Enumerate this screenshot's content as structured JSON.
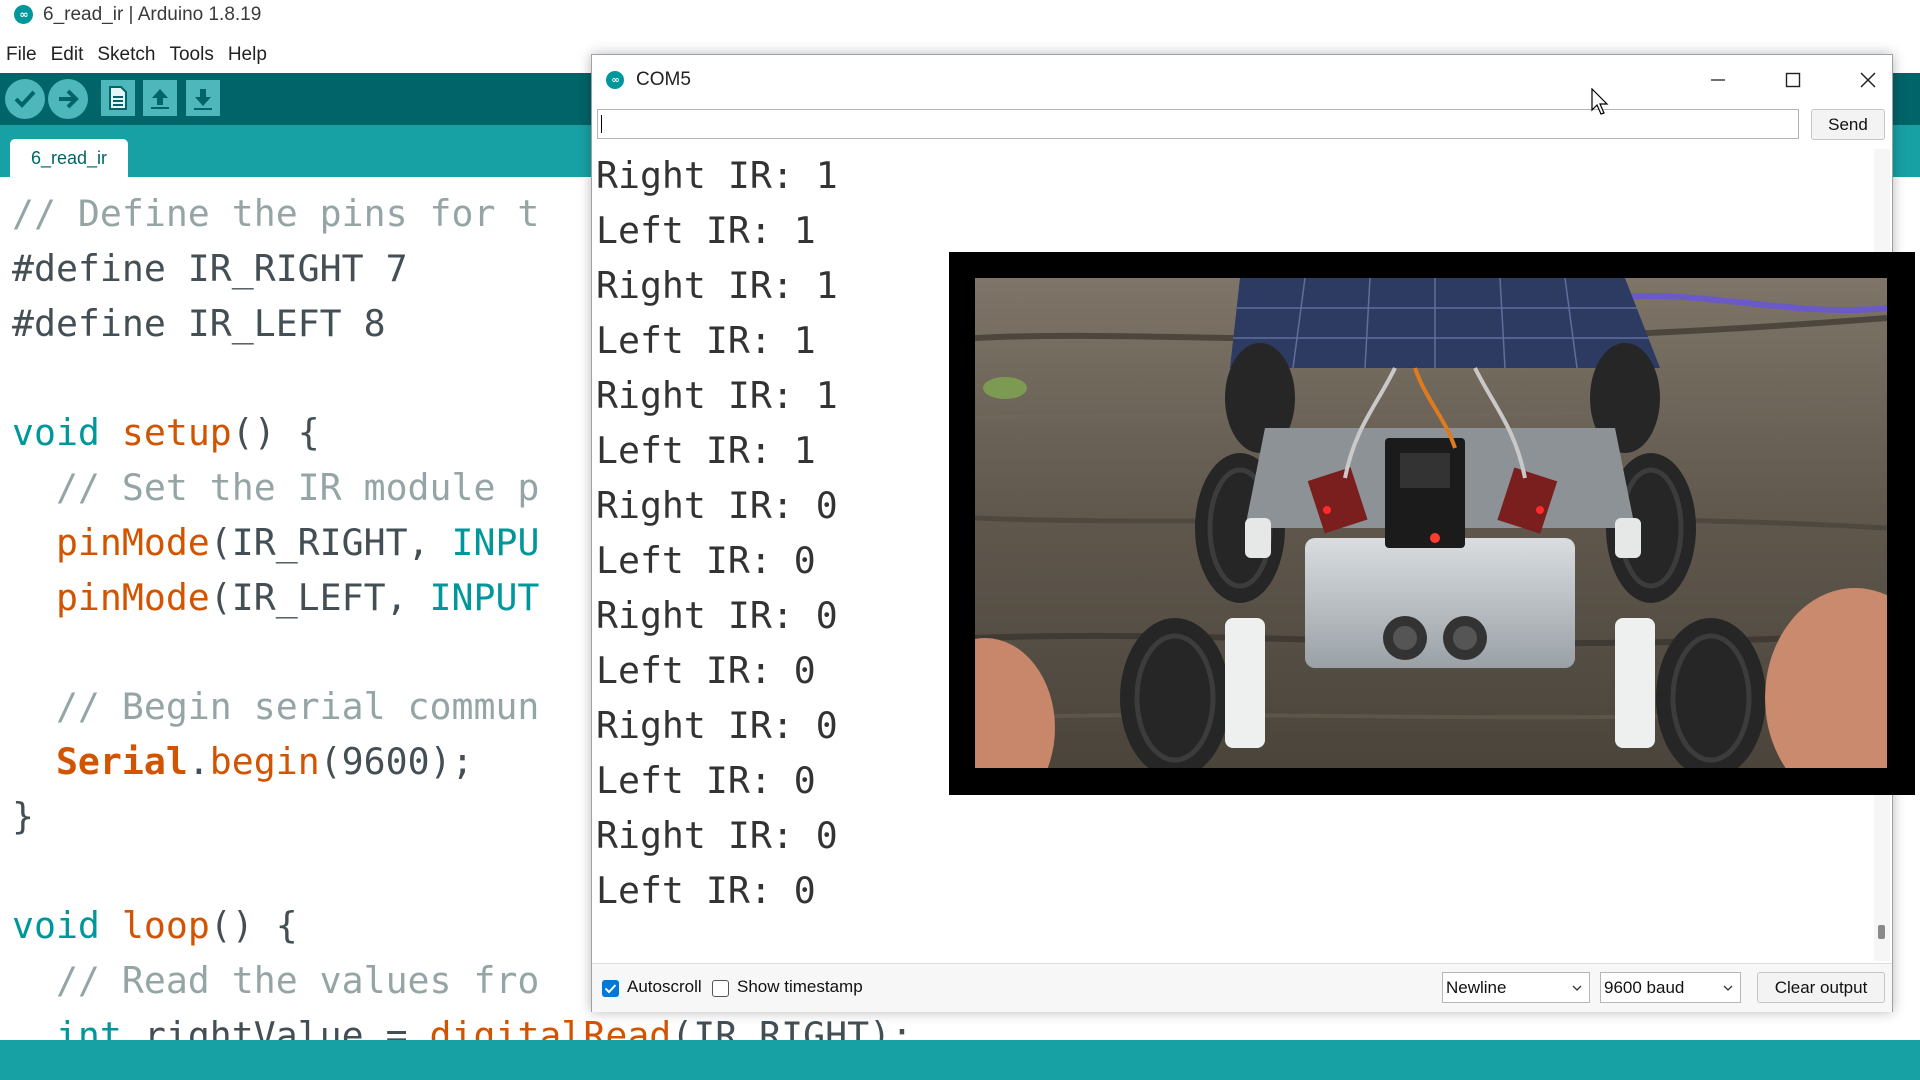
{
  "ide": {
    "window_title": "6_read_ir | Arduino 1.8.19",
    "menu": [
      "File",
      "Edit",
      "Sketch",
      "Tools",
      "Help"
    ],
    "toolbar": {
      "verify_icon": "check-icon",
      "upload_icon": "arrow-right-icon",
      "new_icon": "file-icon",
      "open_icon": "arrow-up-icon",
      "save_icon": "arrow-down-icon"
    },
    "active_tab": "6_read_ir",
    "code": {
      "line1": "// Define the pins for t",
      "line2": "#define IR_RIGHT 7",
      "line3": "#define IR_LEFT 8",
      "line5_kw": "void",
      "line5_fn": "setup",
      "line5_rest": "() {",
      "line6": "// Set the IR module p",
      "line7_fn": "pinMode",
      "line7_rest": "(IR_RIGHT, ",
      "line7_kw": "INPU",
      "line8_fn": "pinMode",
      "line8_rest": "(IR_LEFT, ",
      "line8_kw": "INPUT",
      "line10": "// Begin serial commun",
      "line11_obj": "Serial",
      "line11_dot": ".",
      "line11_fn": "begin",
      "line11_rest": "(9600);",
      "line12": "}",
      "line14_kw": "void",
      "line14_fn": "loop",
      "line14_rest": "() {",
      "line15": "// Read the values fro",
      "line16_kw": "int",
      "line16_mid": " rightValue = ",
      "line16_fn": "digitalRead",
      "line16_rest": "(IR_RIGHT);"
    },
    "colors": {
      "toolbar": "#006468",
      "tabbar": "#17a1a5",
      "keyword": "#00979c",
      "function": "#d35400",
      "comment": "#95a5a6"
    }
  },
  "serial_monitor": {
    "title": "COM5",
    "input_value": "",
    "send_label": "Send",
    "output_lines": [
      "Right IR: 1",
      "Left IR: 1",
      "Right IR: 1",
      "Left IR: 1",
      "Right IR: 1",
      "Left IR: 1",
      "Right IR: 0",
      "Left IR: 0",
      "Right IR: 0",
      "Left IR: 0",
      "Right IR: 0",
      "Left IR: 0",
      "Right IR: 0",
      "Left IR: 0"
    ],
    "autoscroll_label": "Autoscroll",
    "autoscroll_checked": true,
    "timestamp_label": "Show timestamp",
    "timestamp_checked": false,
    "line_ending": "Newline",
    "baud_rate": "9600 baud",
    "clear_label": "Clear output",
    "window_controls": [
      "minimize-icon",
      "maximize-icon",
      "close-icon"
    ]
  },
  "video": {
    "description_icon": "robot-car-photo"
  }
}
